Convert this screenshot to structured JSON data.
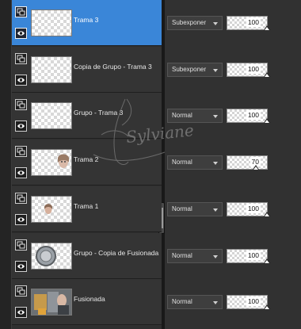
{
  "layers": [
    {
      "name": "Trama 3",
      "blend": "Subexponer",
      "opacity": 100,
      "selected": true,
      "thumb": "empty"
    },
    {
      "name": "Copia de Grupo - Trama 3",
      "blend": "Subexponer",
      "opacity": 100,
      "selected": false,
      "thumb": "empty"
    },
    {
      "name": "Grupo - Trama 3",
      "blend": "Normal",
      "opacity": 100,
      "selected": false,
      "thumb": "empty"
    },
    {
      "name": "Trama 2",
      "blend": "Normal",
      "opacity": 70,
      "selected": false,
      "thumb": "face"
    },
    {
      "name": "Trama 1",
      "blend": "Normal",
      "opacity": 100,
      "selected": false,
      "thumb": "small-face"
    },
    {
      "name": "Grupo - Copia de Fusionada",
      "blend": "Normal",
      "opacity": 100,
      "selected": false,
      "thumb": "circle"
    },
    {
      "name": "Fusionada",
      "blend": "Normal",
      "opacity": 100,
      "selected": false,
      "thumb": "photo"
    }
  ],
  "watermark": {
    "text": "Sylviane"
  },
  "colors": {
    "selected": "#3a86d8",
    "panel": "#2f2f2f",
    "row": "#343434"
  }
}
